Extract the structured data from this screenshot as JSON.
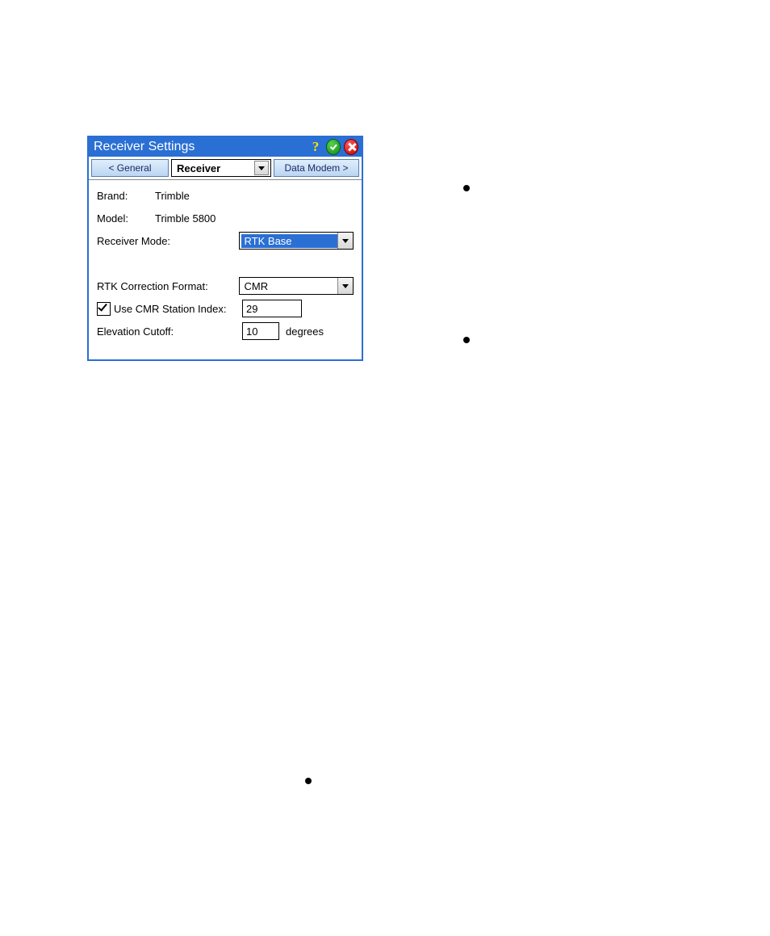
{
  "titlebar": {
    "title": "Receiver Settings"
  },
  "tabs": {
    "prev": "< General",
    "current": "Receiver",
    "next": "Data Modem >"
  },
  "fields": {
    "brand_label": "Brand:",
    "brand_value": "Trimble",
    "model_label": "Model:",
    "model_value": "Trimble 5800",
    "receiver_mode_label": "Receiver Mode:",
    "receiver_mode_value": "RTK Base",
    "rtk_format_label": "RTK Correction Format:",
    "rtk_format_value": "CMR",
    "use_cmr_label": "Use CMR Station Index:",
    "use_cmr_checked": true,
    "cmr_index_value": "29",
    "elev_cutoff_label": "Elevation Cutoff:",
    "elev_cutoff_value": "10",
    "elev_cutoff_unit": "degrees"
  }
}
